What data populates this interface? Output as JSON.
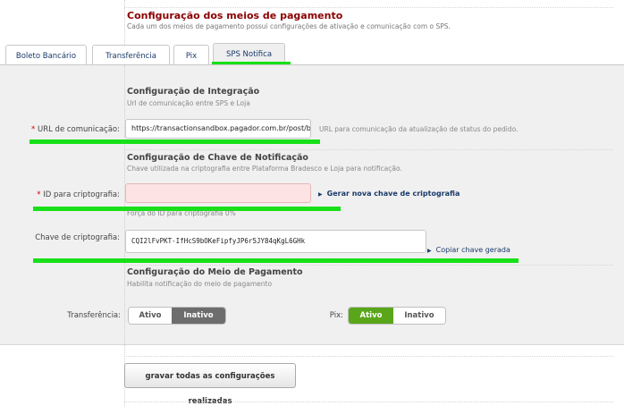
{
  "header": {
    "title": "Configuração dos meios de pagamento",
    "subtitle": "Cada um dos meios de pagamento possui configurações de ativação e comunicação com o SPS."
  },
  "tabs": [
    {
      "label": "Boleto Bancário",
      "active": false
    },
    {
      "label": "Transferência",
      "active": false
    },
    {
      "label": "Pix",
      "active": false
    },
    {
      "label": "SPS Notifica",
      "active": true
    }
  ],
  "integration": {
    "title": "Configuração de Integração",
    "subtitle": "Url de comunicação entre SPS e Loja",
    "url_label": "URL de comunicação:",
    "url_value": "https://transactionsandbox.pagador.com.br/post/bra",
    "url_hint": "URL para comunicação da atualização de status do pedido."
  },
  "notification_key": {
    "title": "Configuração de Chave de Notificação",
    "subtitle": "Chave utilizada na criptografia entre Plataforma Bradesco e Loja para notificação.",
    "id_label": "ID para criptografia:",
    "id_value": "",
    "generate_link": "Gerar nova chave de criptografia",
    "strength_text": "Força do ID para criptografia 0%",
    "key_label": "Chave de criptografia:",
    "key_value": "CQI2lFvPKT-IfHcS9bOKeFipfyJP6r5JY84qKgL6GHk",
    "copy_link": "Copiar chave gerada"
  },
  "payment_method": {
    "title": "Configuração do Meio de Pagamento",
    "subtitle": "Habilita notificação do meio de pagamento",
    "transfer_label": "Transferência:",
    "pix_label": "Pix:",
    "on_label": "Ativo",
    "off_label": "Inativo"
  },
  "save_button": "gravar todas as configurações realizadas",
  "required_mark": "*",
  "colors": {
    "highlight": "#18e018",
    "title": "#8b0000",
    "link": "#1a3a6a",
    "active_green": "#5aa61a",
    "inactive_dark": "#6d6d6d",
    "error_bg": "#fde3e3"
  }
}
